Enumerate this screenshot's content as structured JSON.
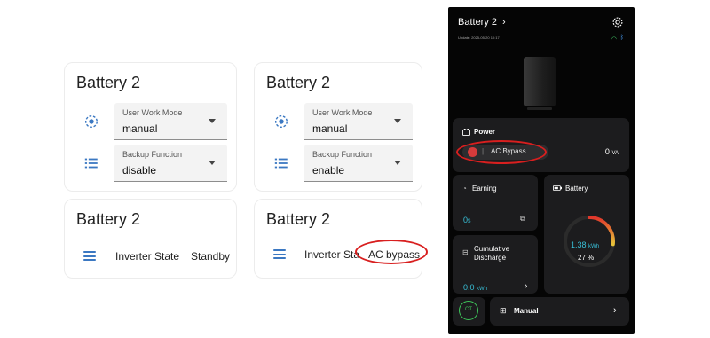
{
  "cards": {
    "left_top": {
      "title": "Battery 2",
      "work_mode": {
        "label": "User Work Mode",
        "value": "manual"
      },
      "backup": {
        "label": "Backup Function",
        "value": "disable"
      }
    },
    "right_top": {
      "title": "Battery 2",
      "work_mode": {
        "label": "User Work Mode",
        "value": "manual"
      },
      "backup": {
        "label": "Backup Function",
        "value": "enable"
      }
    },
    "left_bottom": {
      "title": "Battery 2",
      "entity_name": "Inverter State",
      "entity_state": "Standby"
    },
    "right_bottom": {
      "title": "Battery 2",
      "entity_name": "Inverter Sta",
      "entity_state": "AC bypass"
    }
  },
  "app": {
    "title": "Battery 2",
    "update_time": "Update: 2025-05-20 10:17",
    "power": {
      "label": "Power",
      "mode": "AC Bypass",
      "value": "0",
      "unit": "VA"
    },
    "earning": {
      "label": "Earning",
      "value": "0",
      "unit": "$"
    },
    "battery": {
      "label": "Battery",
      "energy": "1.38",
      "energy_unit": "kWh",
      "soc": "27 %",
      "soc_fraction": 0.27
    },
    "cumulative": {
      "label_line1": "Cumulative",
      "label_line2": "Discharge",
      "value": "0.0",
      "unit": "kWh"
    },
    "ct_label": "CT",
    "mode_button": "Manual"
  },
  "colors": {
    "highlight_red": "#d81f1f",
    "ha_icon_blue": "#3b78c2",
    "app_cyan": "#38c0d8",
    "app_green": "#3ec85a"
  }
}
